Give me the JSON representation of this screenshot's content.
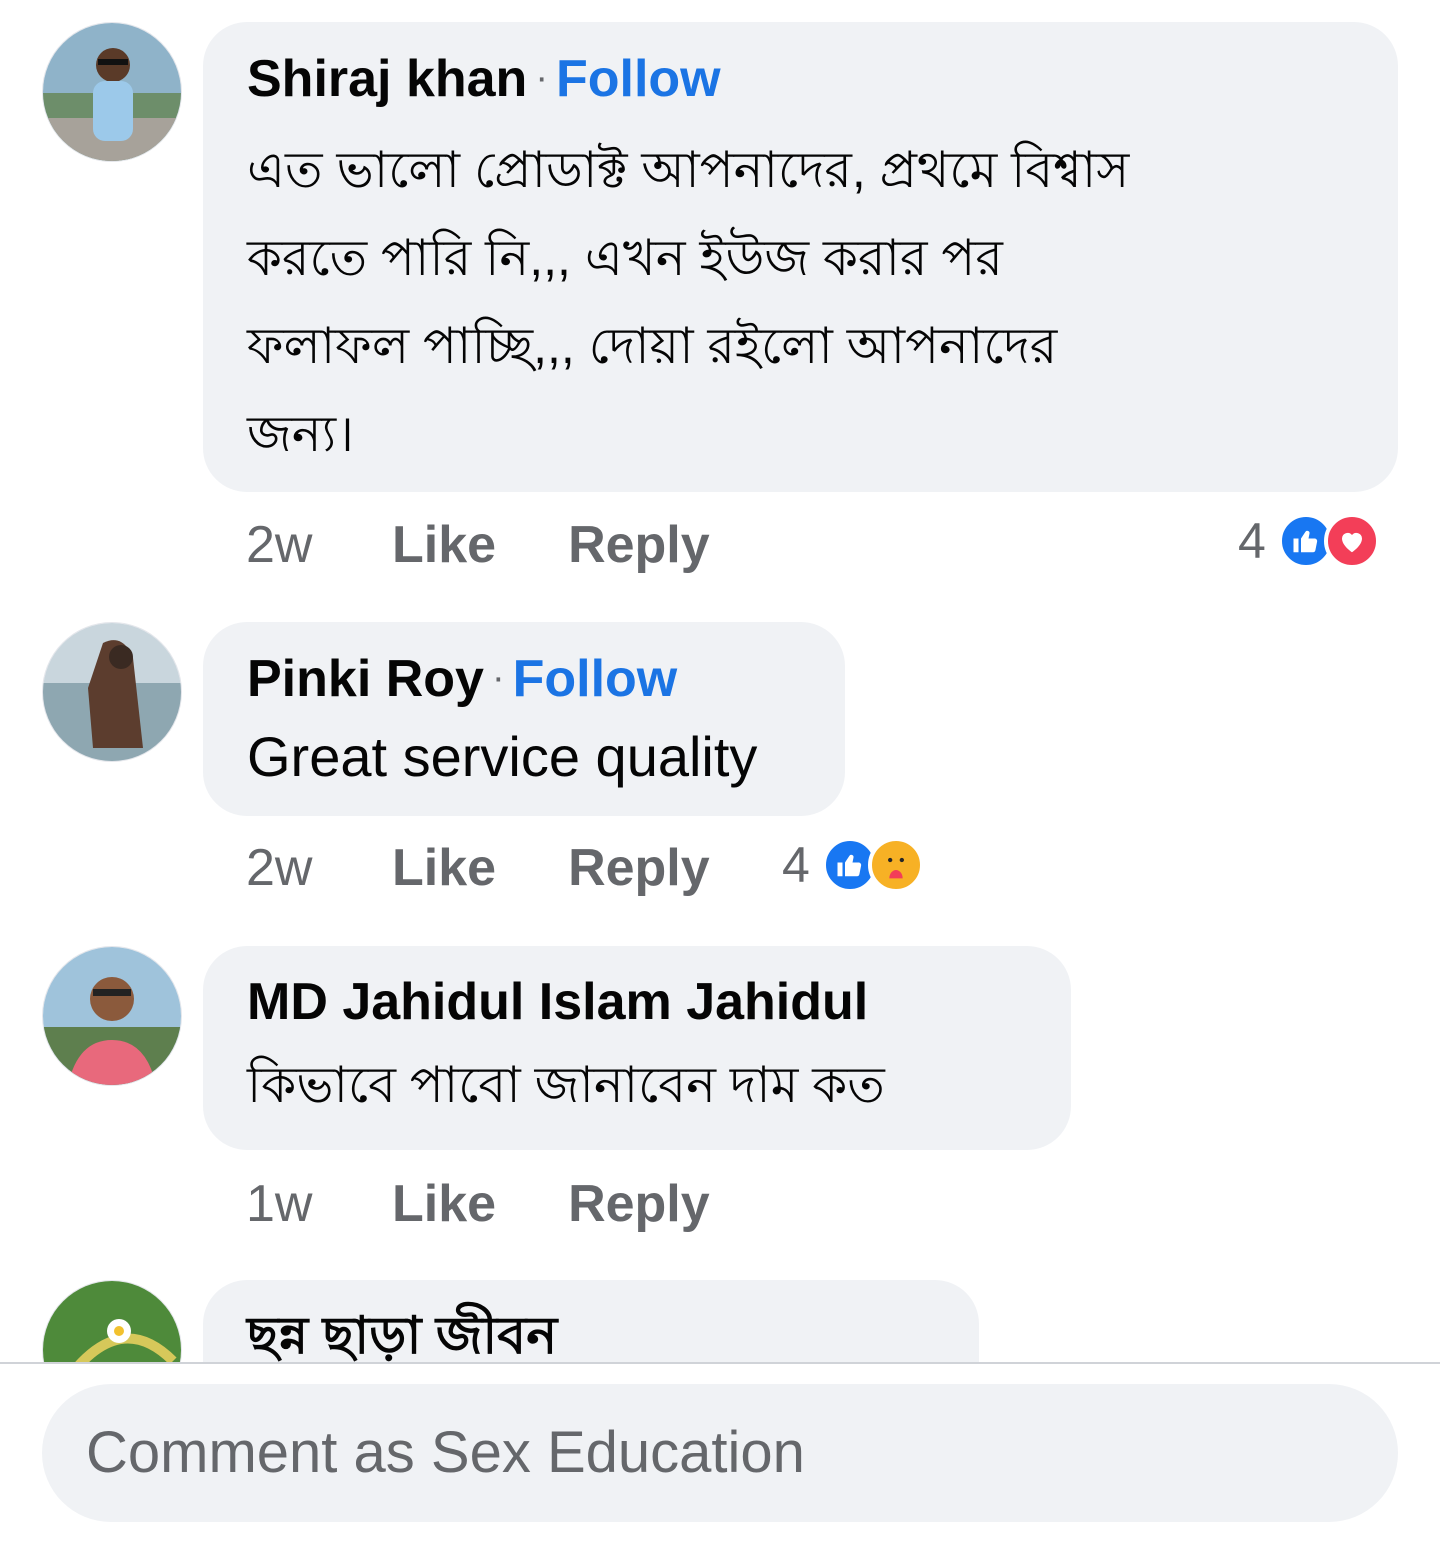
{
  "comments": [
    {
      "author": "Shiraj khan",
      "follow_label": "Follow",
      "separator": "·",
      "text_lines": [
        "এত ভালো প্রোডাক্ট আপনাদের, প্রথমে বিশ্বাস",
        "করতে পারি নি,,, এখন ইউজ করার পর",
        "ফলাফল পাচ্ছি,,, দোয়া রইলো আপনাদের",
        "জন্য।"
      ],
      "time": "2w",
      "like_label": "Like",
      "reply_label": "Reply",
      "reaction_count": "4",
      "reactions": [
        "like-icon",
        "love-icon"
      ]
    },
    {
      "author": "Pinki Roy",
      "follow_label": "Follow",
      "separator": "·",
      "text_lines": [
        "Great service quality"
      ],
      "time": "2w",
      "like_label": "Like",
      "reply_label": "Reply",
      "reaction_count": "4",
      "reactions": [
        "like-icon",
        "care-icon"
      ]
    },
    {
      "author": "MD Jahidul Islam Jahidul",
      "text_lines": [
        "কিভাবে পাবো জানাবেন দাম কত"
      ],
      "time": "1w",
      "like_label": "Like",
      "reply_label": "Reply"
    },
    {
      "author": "ছন্ন ছাড়া জীবন"
    }
  ],
  "composer": {
    "placeholder": "Comment as Sex Education"
  },
  "colors": {
    "bubble": "#f0f2f5",
    "link_blue": "#1b74e4",
    "secondary_text": "#65676b",
    "like_blue": "#1877f2",
    "love_red": "#f33e58"
  }
}
